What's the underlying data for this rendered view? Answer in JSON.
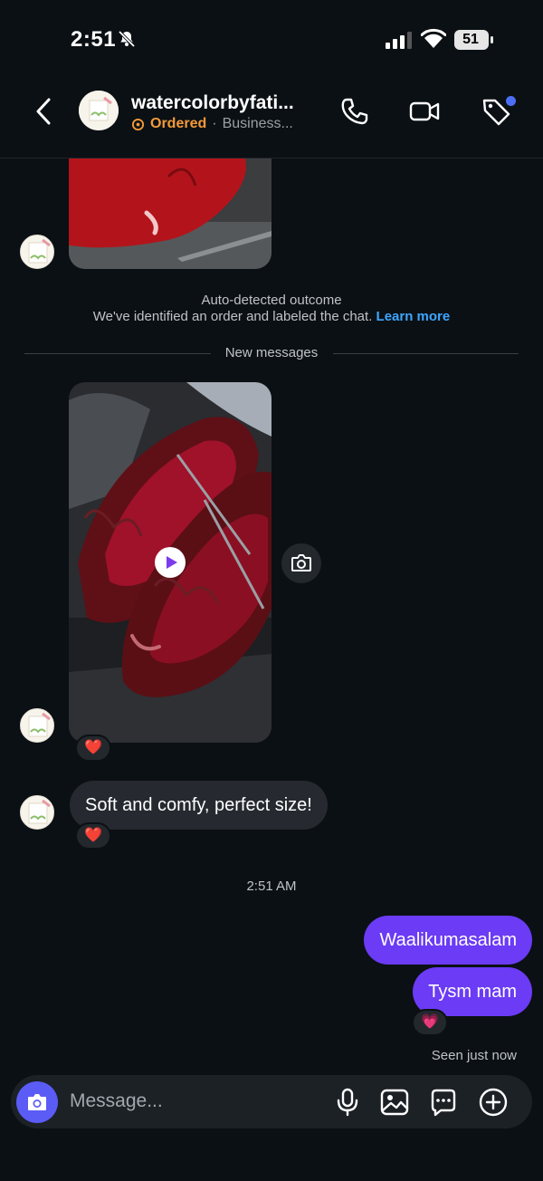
{
  "status_bar": {
    "time": "2:51",
    "battery": "51"
  },
  "header": {
    "title": "watercolorbyfati...",
    "status": "Ordered",
    "separator": "·",
    "account_type": "Business..."
  },
  "chat": {
    "outcome_title": "Auto-detected outcome",
    "outcome_body": "We've identified an order and labeled the chat.",
    "outcome_link": "Learn more",
    "new_messages_label": "New messages",
    "video_reaction": "❤️",
    "incoming_text": "Soft and comfy, perfect size!",
    "incoming_reaction": "❤️",
    "timestamp": "2:51 AM",
    "outgoing_1": "Waalikumasalam",
    "outgoing_2": "Tysm mam",
    "outgoing_reaction": "💗",
    "seen_label": "Seen just now"
  },
  "composer": {
    "placeholder": "Message..."
  },
  "colors": {
    "accent": "#6b3bf5",
    "ordered": "#f39a3a",
    "link": "#3ea6ff",
    "background": "#0b1014"
  },
  "icons": [
    "bell-slash-icon",
    "signal-icon",
    "wifi-icon",
    "battery-icon",
    "back-chevron-icon",
    "phone-icon",
    "video-call-icon",
    "tag-icon",
    "play-icon",
    "camera-icon",
    "mic-icon",
    "gallery-icon",
    "sticker-icon",
    "plus-icon"
  ]
}
